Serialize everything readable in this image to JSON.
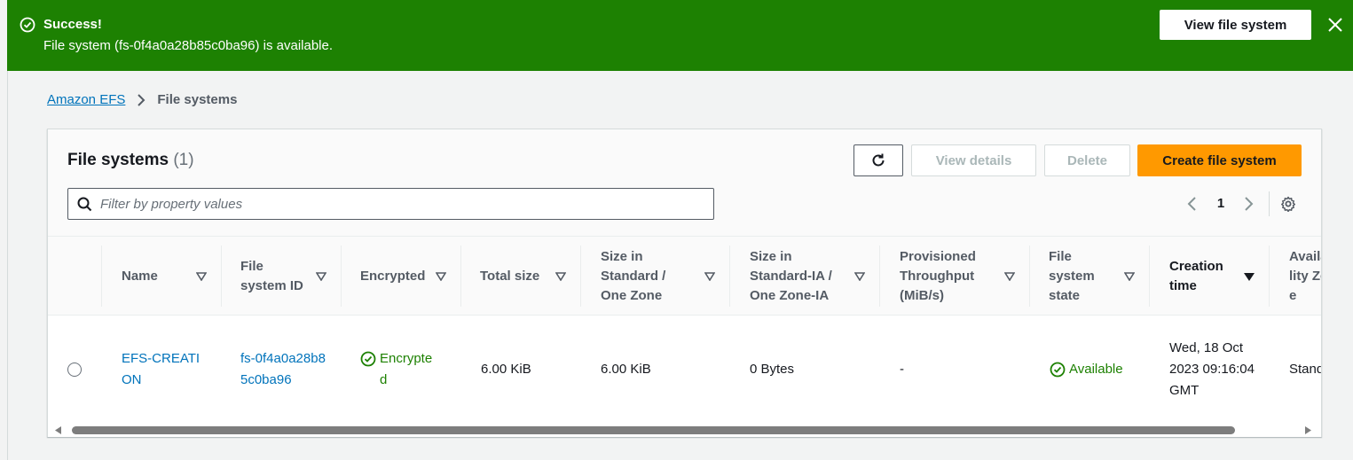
{
  "flash": {
    "title": "Success!",
    "message": "File system (fs-0f4a0a28b85c0ba96) is available.",
    "view_button": "View file system",
    "bg_color": "#1d8102"
  },
  "breadcrumb": {
    "root": "Amazon EFS",
    "current": "File systems"
  },
  "panel": {
    "title": "File systems",
    "count": "(1)",
    "buttons": {
      "view_details": "View details",
      "delete": "Delete",
      "create": "Create file system"
    },
    "filter_placeholder": "Filter by property values",
    "page": "1",
    "accent_color": "#ff9900"
  },
  "table": {
    "columns": [
      {
        "label": "Name"
      },
      {
        "label": "File system ID"
      },
      {
        "label": "Encrypted"
      },
      {
        "label": "Total size"
      },
      {
        "label": "Size in Standard / One Zone"
      },
      {
        "label": "Size in Standard-IA / One Zone-IA"
      },
      {
        "label": "Provisioned Throughput (MiB/s)"
      },
      {
        "label": "File system state"
      },
      {
        "label": "Creation time"
      },
      {
        "label": "Availability Zone"
      }
    ],
    "rows": [
      {
        "name": "EFS-CREATION",
        "file_system_id": "fs-0f4a0a28b85c0ba96",
        "encrypted": "Encrypted",
        "total_size": "6.00 KiB",
        "size_standard": "6.00 KiB",
        "size_ia": "0 Bytes",
        "throughput": "-",
        "state": "Available",
        "creation_time": "Wed, 18 Oct 2023 09:16:04 GMT",
        "availability_zone": "Standard"
      }
    ]
  },
  "icons": {
    "flash_status": "check-circle-icon",
    "flash_close": "close-icon",
    "breadcrumb_sep": "chevron-right-icon",
    "refresh": "refresh-icon",
    "filter": "search-icon",
    "settings": "gear-icon"
  }
}
